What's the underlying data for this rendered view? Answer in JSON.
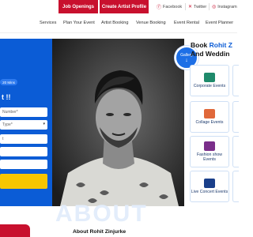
{
  "topbar": {
    "job_openings": "Job Openings",
    "create_profile": "Create Artist Profile",
    "facebook": "Facebook",
    "twitter": "Twitter",
    "instagram": "Instagram"
  },
  "nav": {
    "items": [
      "Services",
      "Plan Your Event",
      "Artist Booking",
      "Venue Booking",
      "Event Rental",
      "Event Planner"
    ]
  },
  "hero": {
    "pill": "20 Mins",
    "headline": "t !!",
    "fields": [
      {
        "placeholder": "Number*"
      },
      {
        "placeholder": "Type*"
      },
      {
        "placeholder": "t"
      },
      {
        "placeholder": ""
      },
      {
        "placeholder": ""
      }
    ],
    "gallery_label": "Gallery",
    "gallery_arrow": "↓"
  },
  "booking": {
    "line1_prefix": "Book ",
    "line1_highlight": "Rohit Z",
    "line2": "And Weddin",
    "categories": [
      {
        "label": "Corporate Events",
        "icon": "corporate-icon",
        "color": "#1f8a6b"
      },
      {
        "label": "Collage Events",
        "icon": "college-icon",
        "color": "#e0683a"
      },
      {
        "label": "Fashion show Events",
        "icon": "fashion-icon",
        "color": "#7a2e8a"
      },
      {
        "label": "Live Concert Events",
        "icon": "concert-icon",
        "color": "#1a3f8a"
      }
    ]
  },
  "about": {
    "watermark": "ABOUT",
    "title": "About Rohit Zinjurke"
  },
  "colors": {
    "brand_red": "#c8102e",
    "brand_blue": "#0b5cd6",
    "cta_yellow": "#f7c600"
  }
}
